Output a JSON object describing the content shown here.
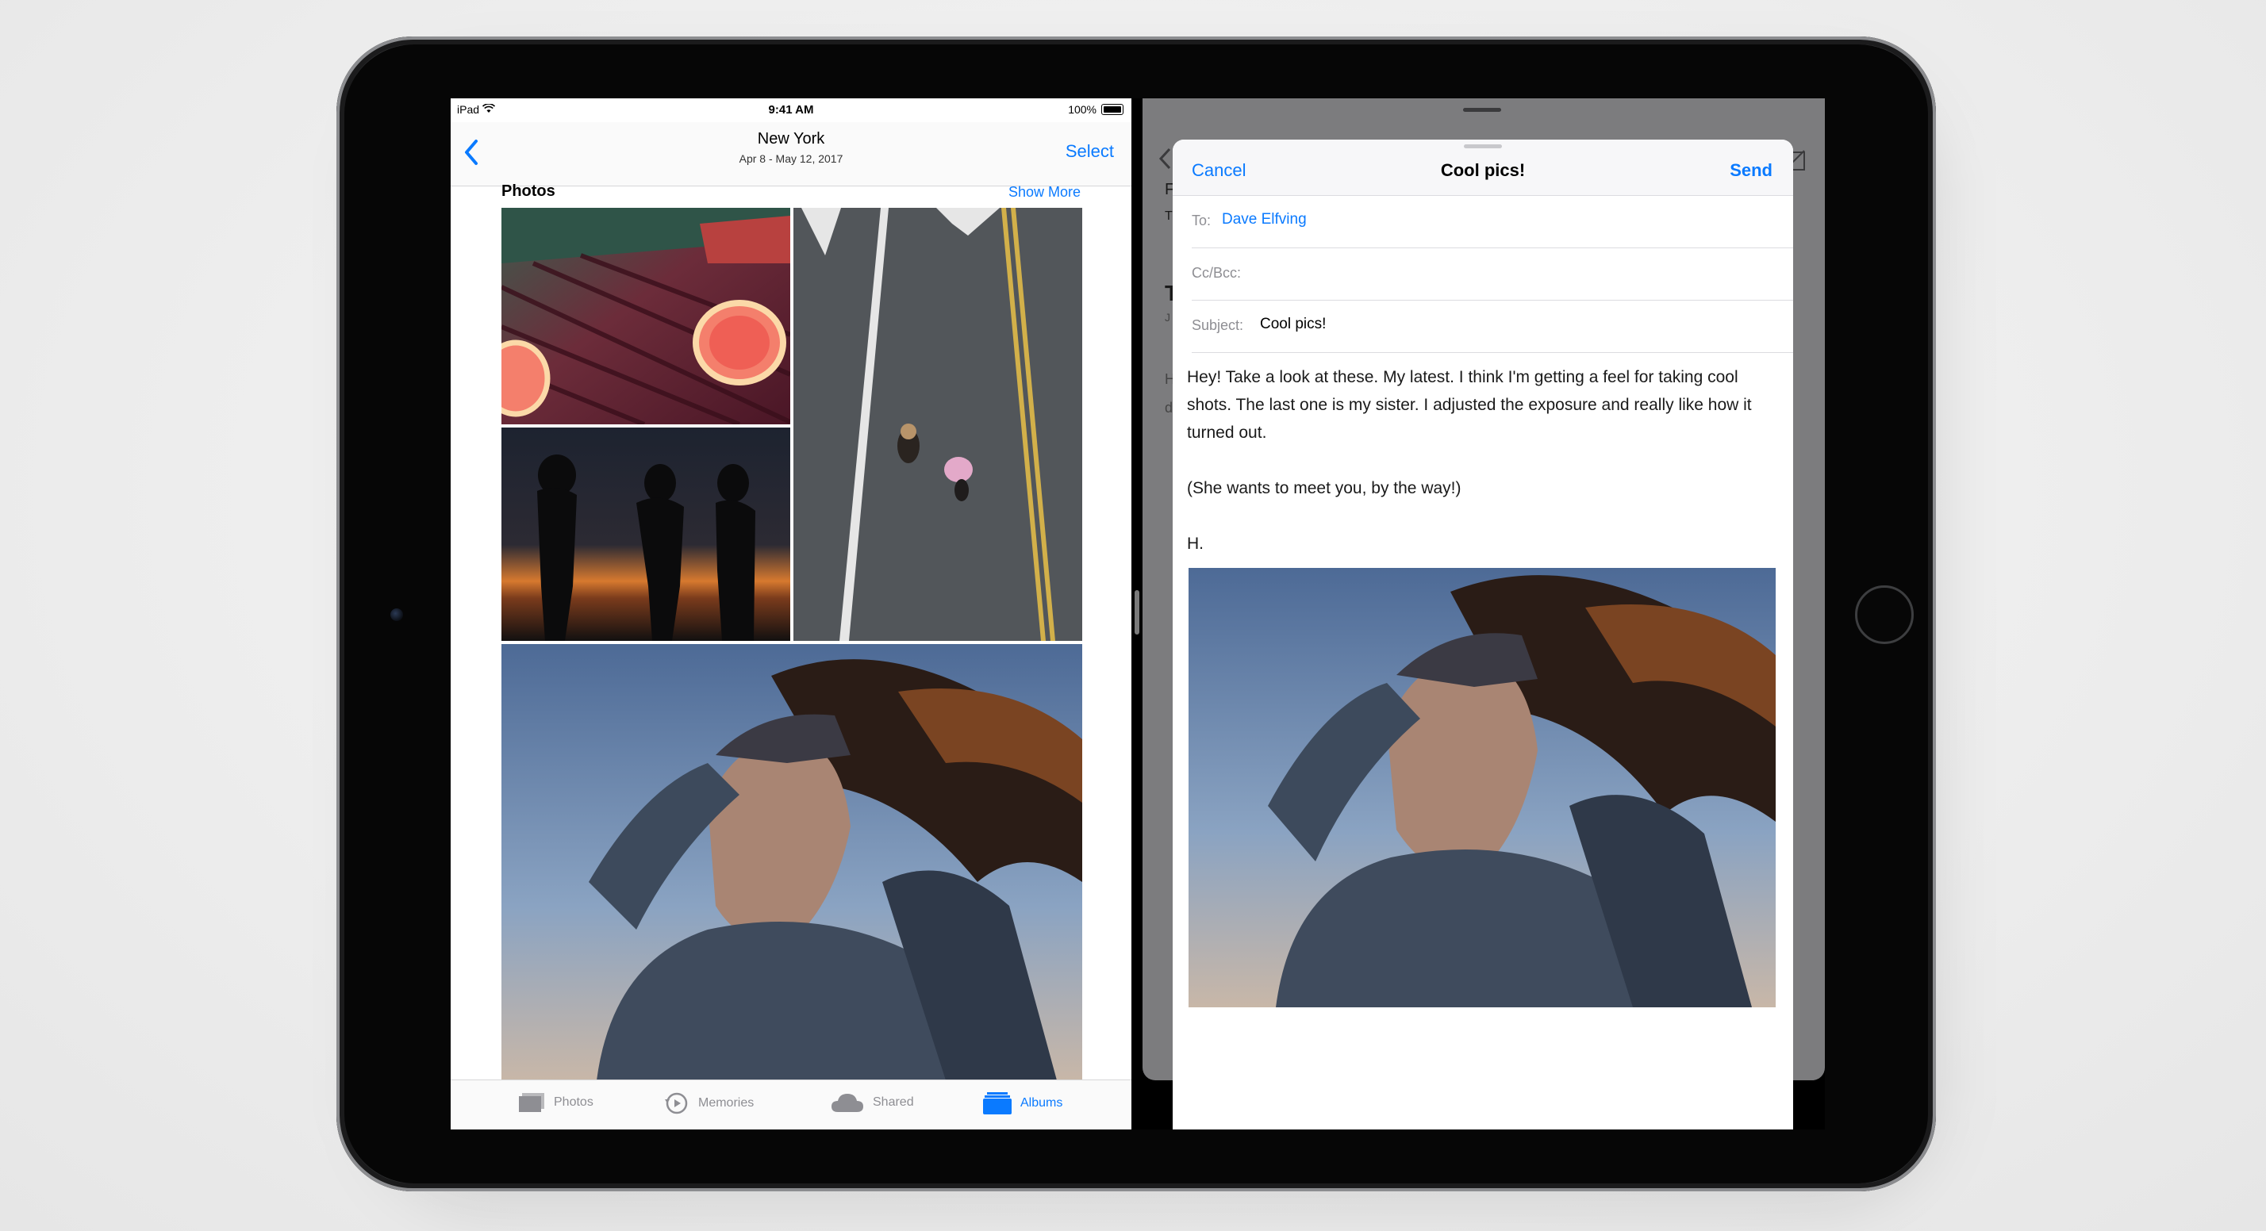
{
  "photos_app": {
    "status": {
      "carrier": "iPad",
      "time": "9:41 AM",
      "battery": "100%"
    },
    "nav": {
      "title": "New York",
      "subtitle": "Apr 8 - May 12, 2017",
      "select_label": "Select"
    },
    "section": {
      "title": "Photos",
      "show_more": "Show More"
    },
    "tabs": [
      {
        "label": "Photos",
        "icon": "photos-tab-icon",
        "active": false
      },
      {
        "label": "Memories",
        "icon": "memories-tab-icon",
        "active": false
      },
      {
        "label": "Shared",
        "icon": "cloud-icon",
        "active": false
      },
      {
        "label": "Albums",
        "icon": "albums-tab-icon",
        "active": true
      }
    ]
  },
  "mail_app": {
    "background": {
      "row1": "F",
      "row2": "T",
      "heading": "T",
      "meta": "J",
      "line1": "H",
      "line2": "d"
    },
    "compose": {
      "cancel_label": "Cancel",
      "title": "Cool pics!",
      "send_label": "Send",
      "to_label": "To:",
      "to_value": "Dave Elfving",
      "ccbcc_label": "Cc/Bcc:",
      "subject_label": "Subject:",
      "subject_value": "Cool pics!",
      "body_paragraph1": "Hey! Take a look at these. My latest. I think I'm getting a feel for taking cool shots. The last one is my sister. I adjusted the exposure and really like how it turned out.",
      "body_paragraph2": "(She wants to meet you, by the way!)",
      "body_signoff": "H."
    }
  },
  "colors": {
    "accent": "#0a7aff",
    "label_gray": "#8e8e93"
  }
}
